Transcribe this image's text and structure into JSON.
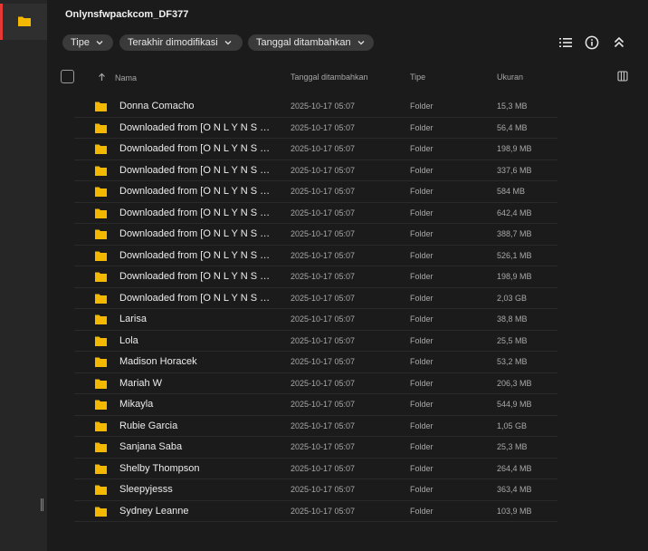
{
  "window": {
    "title": "Onlynsfwpackcom_DF377"
  },
  "filters": [
    {
      "label": "Tipe"
    },
    {
      "label": "Terakhir dimodifikasi"
    },
    {
      "label": "Tanggal ditambahkan"
    }
  ],
  "toolbar_icons": [
    "list-view-icon",
    "info-icon",
    "collapse-icon"
  ],
  "columns": {
    "name": "Nama",
    "date": "Tanggal ditambahkan",
    "type": "Tipe",
    "size": "Ukuran"
  },
  "sort": {
    "column": "Nama",
    "direction": "ascending"
  },
  "colors": {
    "accent": "#e53935",
    "folder": "#f5b800",
    "background": "#1b1b1b",
    "chip": "#3a3a3a"
  },
  "rows": [
    {
      "name": "Donna Comacho",
      "date": "2025-10-17 05:07",
      "type": "Folder",
      "size": "15,3 MB"
    },
    {
      "name": "Downloaded from [O N L Y N S F W P A C K . C O M]",
      "date": "2025-10-17 05:07",
      "type": "Folder",
      "size": "56,4 MB"
    },
    {
      "name": "Downloaded from [O N L Y N S F W P A C K . C O M]",
      "date": "2025-10-17 05:07",
      "type": "Folder",
      "size": "198,9 MB"
    },
    {
      "name": "Downloaded from [O N L Y N S F W P A C K . C O M]",
      "date": "2025-10-17 05:07",
      "type": "Folder",
      "size": "337,6 MB"
    },
    {
      "name": "Downloaded from [O N L Y N S F W P A C K . C O M]",
      "date": "2025-10-17 05:07",
      "type": "Folder",
      "size": "584 MB"
    },
    {
      "name": "Downloaded from [O N L Y N S F W P A C K . C O M]",
      "date": "2025-10-17 05:07",
      "type": "Folder",
      "size": "642,4 MB"
    },
    {
      "name": "Downloaded from [O N L Y N S F W P A C K . C O M]",
      "date": "2025-10-17 05:07",
      "type": "Folder",
      "size": "388,7 MB"
    },
    {
      "name": "Downloaded from [O N L Y N S F W P A C K . C O M]",
      "date": "2025-10-17 05:07",
      "type": "Folder",
      "size": "526,1 MB"
    },
    {
      "name": "Downloaded from [O N L Y N S F W P A C K . C O M]",
      "date": "2025-10-17 05:07",
      "type": "Folder",
      "size": "198,9 MB"
    },
    {
      "name": "Downloaded from [O N L Y N S F W P A C K . C O M]",
      "date": "2025-10-17 05:07",
      "type": "Folder",
      "size": "2,03 GB"
    },
    {
      "name": "Larisa",
      "date": "2025-10-17 05:07",
      "type": "Folder",
      "size": "38,8 MB"
    },
    {
      "name": "Lola",
      "date": "2025-10-17 05:07",
      "type": "Folder",
      "size": "25,5 MB"
    },
    {
      "name": "Madison Horacek",
      "date": "2025-10-17 05:07",
      "type": "Folder",
      "size": "53,2 MB"
    },
    {
      "name": "Mariah W",
      "date": "2025-10-17 05:07",
      "type": "Folder",
      "size": "206,3 MB"
    },
    {
      "name": "Mikayla",
      "date": "2025-10-17 05:07",
      "type": "Folder",
      "size": "544,9 MB"
    },
    {
      "name": "Rubie Garcia",
      "date": "2025-10-17 05:07",
      "type": "Folder",
      "size": "1,05 GB"
    },
    {
      "name": "Sanjana Saba",
      "date": "2025-10-17 05:07",
      "type": "Folder",
      "size": "25,3 MB"
    },
    {
      "name": "Shelby Thompson",
      "date": "2025-10-17 05:07",
      "type": "Folder",
      "size": "264,4 MB"
    },
    {
      "name": "Sleepyjesss",
      "date": "2025-10-17 05:07",
      "type": "Folder",
      "size": "363,4 MB"
    },
    {
      "name": "Sydney Leanne",
      "date": "2025-10-17 05:07",
      "type": "Folder",
      "size": "103,9 MB"
    }
  ]
}
